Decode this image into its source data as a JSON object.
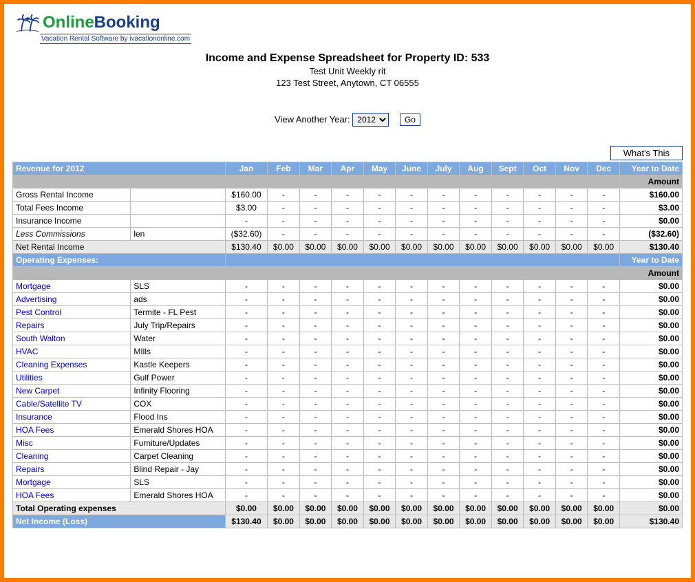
{
  "logo": {
    "online": "Online",
    "booking": "Booking",
    "tag": "Vacation Rental Software by ivacationonline.com"
  },
  "header": {
    "title": "Income and Expense Spreadsheet for Property ID: 533",
    "unit": "Test Unit Weekly rit",
    "address": "123 Test Street, Anytown, CT 06555"
  },
  "year_picker": {
    "label": "View Another Year:",
    "selected": "2012",
    "go": "Go"
  },
  "whats_this": "What's This",
  "months": [
    "Jan",
    "Feb",
    "Mar",
    "Apr",
    "May",
    "June",
    "July",
    "Aug",
    "Sept",
    "Oct",
    "Nov",
    "Dec"
  ],
  "revenue": {
    "header": "Revenue for 2012",
    "ytd_label": "Year to Date",
    "amount_label": "Amount",
    "rows": [
      {
        "name": "Gross Rental Income",
        "note": "",
        "link": false,
        "vals": [
          "$160.00",
          "-",
          "-",
          "-",
          "-",
          "-",
          "-",
          "-",
          "-",
          "-",
          "-",
          "-"
        ],
        "ytd": "$160.00"
      },
      {
        "name": "Total Fees Income",
        "note": "",
        "link": false,
        "vals": [
          "$3.00",
          "-",
          "-",
          "-",
          "-",
          "-",
          "-",
          "-",
          "-",
          "-",
          "-",
          "-"
        ],
        "ytd": "$3.00"
      },
      {
        "name": "Insurance Income",
        "note": "",
        "link": false,
        "vals": [
          "-",
          "-",
          "-",
          "-",
          "-",
          "-",
          "-",
          "-",
          "-",
          "-",
          "-",
          "-"
        ],
        "ytd": "$0.00"
      },
      {
        "name": "Less Commissions",
        "note": "len",
        "link": false,
        "italic": true,
        "vals": [
          "($32.60)",
          "-",
          "-",
          "-",
          "-",
          "-",
          "-",
          "-",
          "-",
          "-",
          "-",
          "-"
        ],
        "ytd": "($32.60)"
      }
    ],
    "net": {
      "name": "Net Rental Income",
      "vals": [
        "$130.40",
        "$0.00",
        "$0.00",
        "$0.00",
        "$0.00",
        "$0.00",
        "$0.00",
        "$0.00",
        "$0.00",
        "$0.00",
        "$0.00",
        "$0.00"
      ],
      "ytd": "$130.40"
    }
  },
  "expenses": {
    "header": "Operating Expenses:",
    "ytd_label": "Year to Date",
    "amount_label": "Amount",
    "rows": [
      {
        "name": "Mortgage",
        "note": "SLS",
        "link": true,
        "vals": [
          "-",
          "-",
          "-",
          "-",
          "-",
          "-",
          "-",
          "-",
          "-",
          "-",
          "-",
          "-"
        ],
        "ytd": "$0.00"
      },
      {
        "name": "Advertising",
        "note": "ads",
        "link": true,
        "vals": [
          "-",
          "-",
          "-",
          "-",
          "-",
          "-",
          "-",
          "-",
          "-",
          "-",
          "-",
          "-"
        ],
        "ytd": "$0.00"
      },
      {
        "name": "Pest Control",
        "note": "Termite - FL Pest",
        "link": true,
        "vals": [
          "-",
          "-",
          "-",
          "-",
          "-",
          "-",
          "-",
          "-",
          "-",
          "-",
          "-",
          "-"
        ],
        "ytd": "$0.00"
      },
      {
        "name": "Repairs",
        "note": "July Trip/Repairs",
        "link": true,
        "vals": [
          "-",
          "-",
          "-",
          "-",
          "-",
          "-",
          "-",
          "-",
          "-",
          "-",
          "-",
          "-"
        ],
        "ytd": "$0.00"
      },
      {
        "name": "South Walton",
        "note": "Water",
        "link": true,
        "vals": [
          "-",
          "-",
          "-",
          "-",
          "-",
          "-",
          "-",
          "-",
          "-",
          "-",
          "-",
          "-"
        ],
        "ytd": "$0.00"
      },
      {
        "name": "HVAC",
        "note": "MIlls",
        "link": true,
        "vals": [
          "-",
          "-",
          "-",
          "-",
          "-",
          "-",
          "-",
          "-",
          "-",
          "-",
          "-",
          "-"
        ],
        "ytd": "$0.00"
      },
      {
        "name": "Cleaning Expenses",
        "note": "Kastle Keepers",
        "link": true,
        "vals": [
          "-",
          "-",
          "-",
          "-",
          "-",
          "-",
          "-",
          "-",
          "-",
          "-",
          "-",
          "-"
        ],
        "ytd": "$0.00"
      },
      {
        "name": "Utilities",
        "note": "Gulf Power",
        "link": true,
        "vals": [
          "-",
          "-",
          "-",
          "-",
          "-",
          "-",
          "-",
          "-",
          "-",
          "-",
          "-",
          "-"
        ],
        "ytd": "$0.00"
      },
      {
        "name": "New Carpet",
        "note": "Infinity Flooring",
        "link": true,
        "vals": [
          "-",
          "-",
          "-",
          "-",
          "-",
          "-",
          "-",
          "-",
          "-",
          "-",
          "-",
          "-"
        ],
        "ytd": "$0.00"
      },
      {
        "name": "Cable/Satellite TV",
        "note": "COX",
        "link": true,
        "vals": [
          "-",
          "-",
          "-",
          "-",
          "-",
          "-",
          "-",
          "-",
          "-",
          "-",
          "-",
          "-"
        ],
        "ytd": "$0.00"
      },
      {
        "name": "Insurance",
        "note": "Flood Ins",
        "link": true,
        "vals": [
          "-",
          "-",
          "-",
          "-",
          "-",
          "-",
          "-",
          "-",
          "-",
          "-",
          "-",
          "-"
        ],
        "ytd": "$0.00"
      },
      {
        "name": "HOA Fees",
        "note": "Emerald Shores HOA",
        "link": true,
        "vals": [
          "-",
          "-",
          "-",
          "-",
          "-",
          "-",
          "-",
          "-",
          "-",
          "-",
          "-",
          "-"
        ],
        "ytd": "$0.00"
      },
      {
        "name": "Misc",
        "note": "Furniture/Updates",
        "link": true,
        "vals": [
          "-",
          "-",
          "-",
          "-",
          "-",
          "-",
          "-",
          "-",
          "-",
          "-",
          "-",
          "-"
        ],
        "ytd": "$0.00"
      },
      {
        "name": "Cleaning",
        "note": "Carpet Cleaning",
        "link": true,
        "vals": [
          "-",
          "-",
          "-",
          "-",
          "-",
          "-",
          "-",
          "-",
          "-",
          "-",
          "-",
          "-"
        ],
        "ytd": "$0.00"
      },
      {
        "name": "Repairs",
        "note": "Blind Repair - Jay",
        "link": true,
        "vals": [
          "-",
          "-",
          "-",
          "-",
          "-",
          "-",
          "-",
          "-",
          "-",
          "-",
          "-",
          "-"
        ],
        "ytd": "$0.00"
      },
      {
        "name": "Mortgage",
        "note": "SLS",
        "link": true,
        "vals": [
          "-",
          "-",
          "-",
          "-",
          "-",
          "-",
          "-",
          "-",
          "-",
          "-",
          "-",
          "-"
        ],
        "ytd": "$0.00"
      },
      {
        "name": "HOA Fees",
        "note": "Emerald Shores HOA",
        "link": true,
        "vals": [
          "-",
          "-",
          "-",
          "-",
          "-",
          "-",
          "-",
          "-",
          "-",
          "-",
          "-",
          "-"
        ],
        "ytd": "$0.00"
      }
    ],
    "total": {
      "name": "Total Operating expenses",
      "vals": [
        "$0.00",
        "$0.00",
        "$0.00",
        "$0.00",
        "$0.00",
        "$0.00",
        "$0.00",
        "$0.00",
        "$0.00",
        "$0.00",
        "$0.00",
        "$0.00"
      ],
      "ytd": "$0.00"
    }
  },
  "net_income": {
    "name": "Net Income (Loss)",
    "vals": [
      "$130.40",
      "$0.00",
      "$0.00",
      "$0.00",
      "$0.00",
      "$0.00",
      "$0.00",
      "$0.00",
      "$0.00",
      "$0.00",
      "$0.00",
      "$0.00"
    ],
    "ytd": "$130.40"
  }
}
